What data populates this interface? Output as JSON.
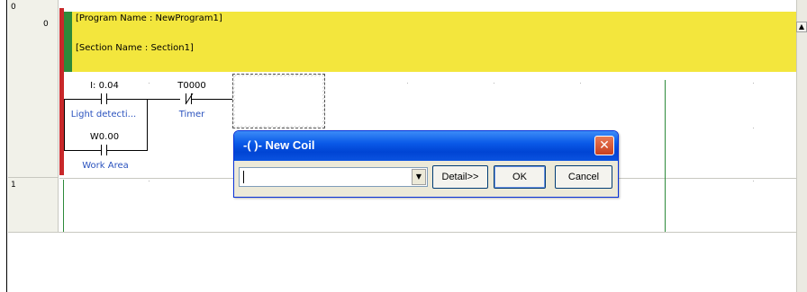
{
  "rows": [
    {
      "index": "0",
      "step": "0"
    },
    {
      "index": "1"
    }
  ],
  "header": {
    "program_name": "[Program Name : NewProgram1]",
    "section_name": "[Section Name : Section1]"
  },
  "ladder": {
    "contact1": {
      "address": "I: 0.04",
      "comment": "Light detecti..."
    },
    "contact2": {
      "address": "T0000",
      "comment": "Timer"
    },
    "contact3": {
      "address": "W0.00",
      "comment": "Work Area"
    }
  },
  "dialog": {
    "title": "-( )- New Coil",
    "input_value": "",
    "detail_label": "Detail>>",
    "ok_label": "OK",
    "cancel_label": "Cancel"
  },
  "colors": {
    "header_yellow": "#f3e63d",
    "rail_red": "#c8282a",
    "section_green": "#2d8a3a",
    "comment_blue": "#2a52be",
    "titlebar_blue": "#0a5ae8"
  }
}
